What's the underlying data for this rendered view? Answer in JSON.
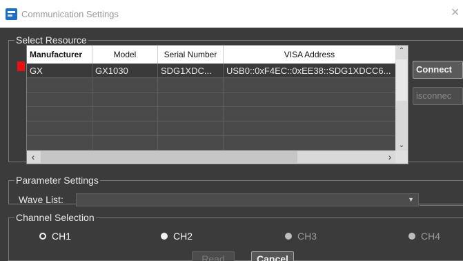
{
  "window": {
    "title": "Communication Settings",
    "close_icon": "close-icon",
    "app_icon": "app-icon"
  },
  "resource": {
    "legend": "Select Resource",
    "columns": [
      "Manufacturer",
      "Model",
      "Serial Number",
      "VISA Address"
    ],
    "rows": [
      [
        "GX",
        "GX1030",
        "SDG1XDC...",
        "USB0::0xF4EC::0xEE38::SDG1XDCC6..."
      ]
    ],
    "status_color": "#e81010",
    "connect_label": "Connect",
    "disconnect_label": "isconnec"
  },
  "parameters": {
    "legend": "Parameter Settings",
    "wave_list_label": "Wave List:",
    "wave_list_value": ""
  },
  "channels": {
    "legend": "Channel Selection",
    "items": [
      {
        "label": "CH1",
        "state": "selected"
      },
      {
        "label": "CH2",
        "state": "enabled"
      },
      {
        "label": "CH3",
        "state": "disabled"
      },
      {
        "label": "CH4",
        "state": "disabled"
      }
    ]
  },
  "actions": {
    "read_label": "Read",
    "cancel_label": "Cancel"
  }
}
